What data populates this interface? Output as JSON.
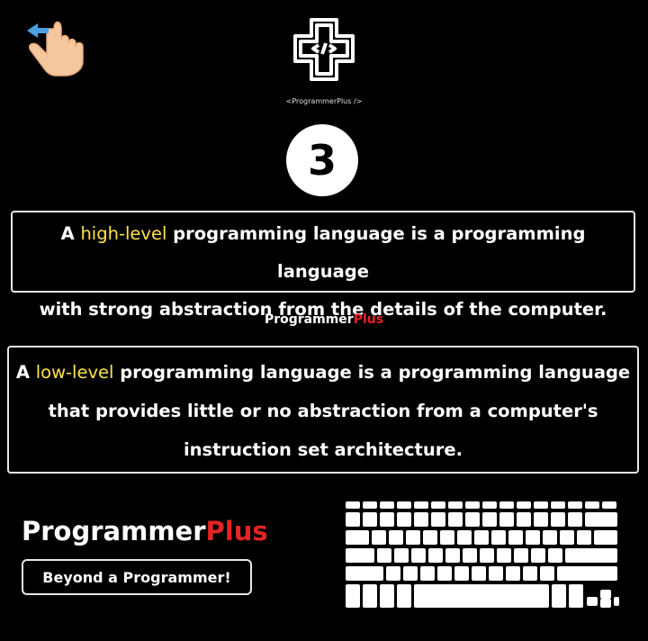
{
  "header": {
    "tagline": "<ProgrammerPlus />",
    "slide_number": "3"
  },
  "card_high": {
    "prefix": "A ",
    "highlight": "high-level",
    "line1_rest": " programming language is a programming language",
    "line2": "with strong abstraction from the details of the computer."
  },
  "mid_brand": {
    "part1": "Programmer",
    "part2": "Plus"
  },
  "card_low": {
    "prefix": "A ",
    "highlight": "low-level",
    "line1_rest": " programming language is a programming language",
    "line2": "that provides little or no abstraction from a computer's",
    "line3": "instruction set architecture."
  },
  "footer": {
    "brand_part1": "Programmer",
    "brand_part2": "Plus",
    "button_label": "Beyond a Programmer!"
  },
  "icons": {
    "swipe": "swipe-left-hand-icon",
    "logo": "programmerplus-logo-icon",
    "keyboard": "keyboard-icon"
  },
  "colors": {
    "background": "#000000",
    "highlight": "#ffe24a",
    "accent_red": "#e32424",
    "text": "#ffffff"
  }
}
